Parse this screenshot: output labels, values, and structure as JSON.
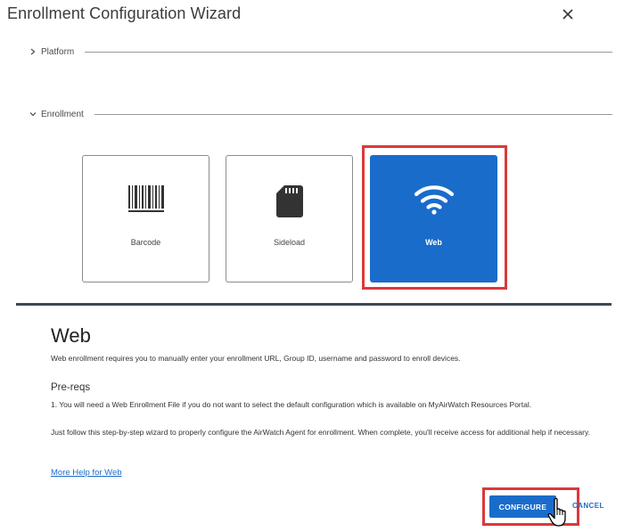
{
  "dialog": {
    "title": "Enrollment Configuration Wizard",
    "close_icon": "close-icon"
  },
  "sections": {
    "platform": {
      "label": "Platform",
      "expanded": false
    },
    "enrollment": {
      "label": "Enrollment",
      "expanded": true
    }
  },
  "options": [
    {
      "label": "Barcode",
      "icon": "barcode-icon",
      "selected": false
    },
    {
      "label": "Sideload",
      "icon": "sd-card-icon",
      "selected": false
    },
    {
      "label": "Web",
      "icon": "wifi-icon",
      "selected": true
    }
  ],
  "detail": {
    "title": "Web",
    "description": "Web enrollment requires you to manually enter your enrollment URL, Group ID, username and password to enroll devices.",
    "prereqs_title": "Pre-reqs",
    "prereq_item": "1. You will need a Web Enrollment File if you do not want to select the default configuration which is available on MyAirWatch Resources Portal.",
    "follow_text": "Just follow this step-by-step wizard to properly configure the AirWatch Agent for enrollment. When complete, you'll receive access for additional help if necessary.",
    "help_link": "More Help for Web"
  },
  "footer": {
    "configure_label": "CONFIGURE",
    "cancel_label": "CANCEL"
  },
  "colors": {
    "accent": "#1a6ccb",
    "highlight": "#d9393b",
    "divider": "#3c4a55"
  }
}
